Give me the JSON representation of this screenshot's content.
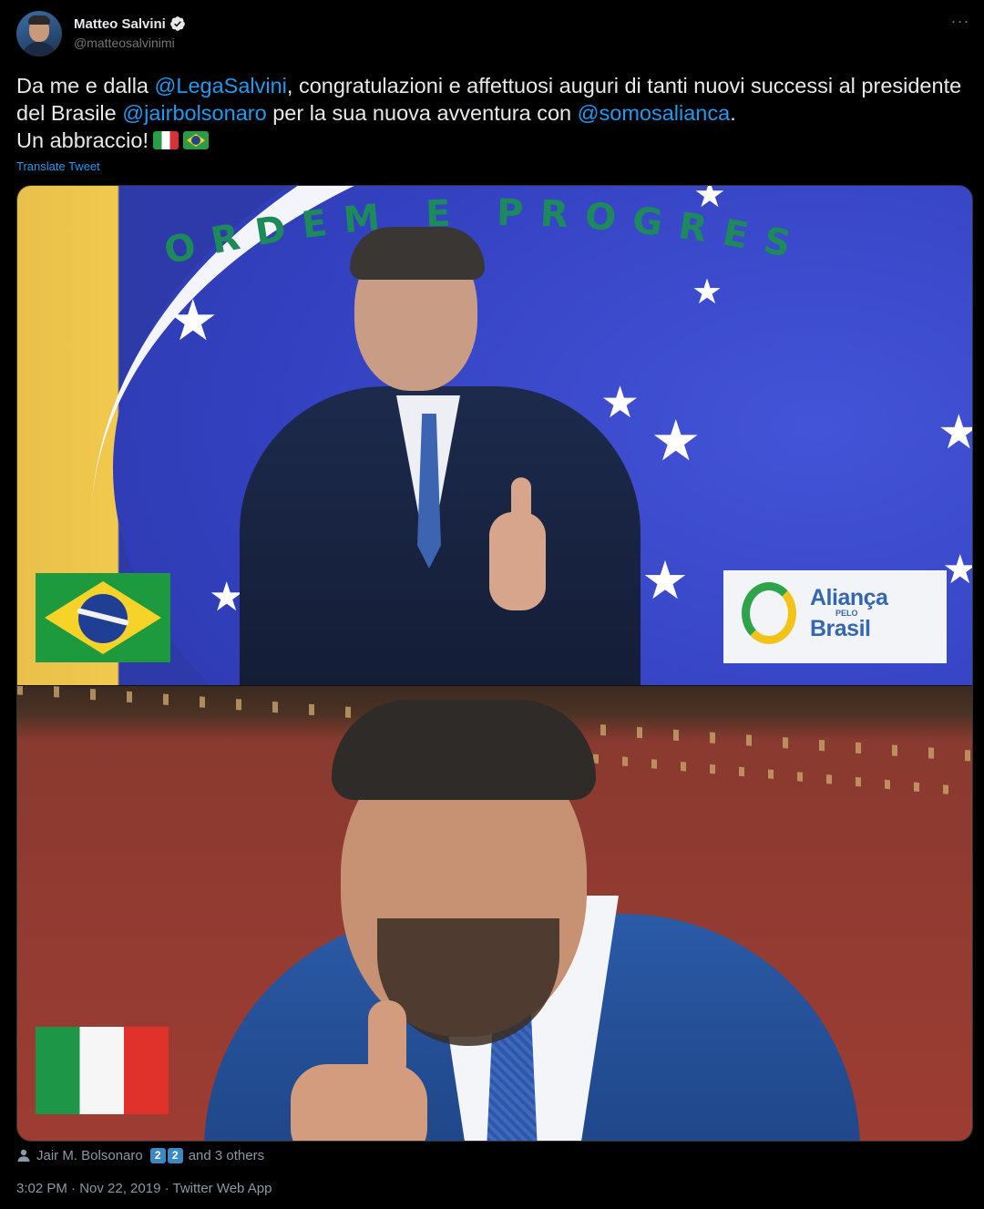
{
  "author": {
    "name": "Matteo Salvini",
    "handle": "@matteosalvinimi"
  },
  "menu": {
    "more_label": "···"
  },
  "tweet": {
    "text_1": "Da me e dalla ",
    "mention_1": "@LegaSalvini",
    "text_2": ", congratulazioni e affettuosi auguri di tanti nuovi successi al presidente del Brasile ",
    "mention_2": "@jairbolsonaro",
    "text_3": " per la sua nuova avventura con ",
    "mention_3": "@somosalianca",
    "text_4": ".",
    "text_5": "Un abbraccio!"
  },
  "translate_label": "Translate Tweet",
  "media": {
    "motto": "ORDEM E PROGRES",
    "logo_line_1": "Aliança",
    "logo_line_2": "PELO",
    "logo_line_3": "Brasil"
  },
  "liked_by": {
    "name": "Jair M. Bolsonaro",
    "badge_1": "2",
    "badge_2": "2",
    "suffix": "and 3 others"
  },
  "meta": "3:02 PM · Nov 22, 2019 · Twitter Web App",
  "colors": {
    "accent": "#1d9bf0",
    "background": "#000000",
    "text": "#e7e9ea",
    "muted": "#71767b"
  }
}
